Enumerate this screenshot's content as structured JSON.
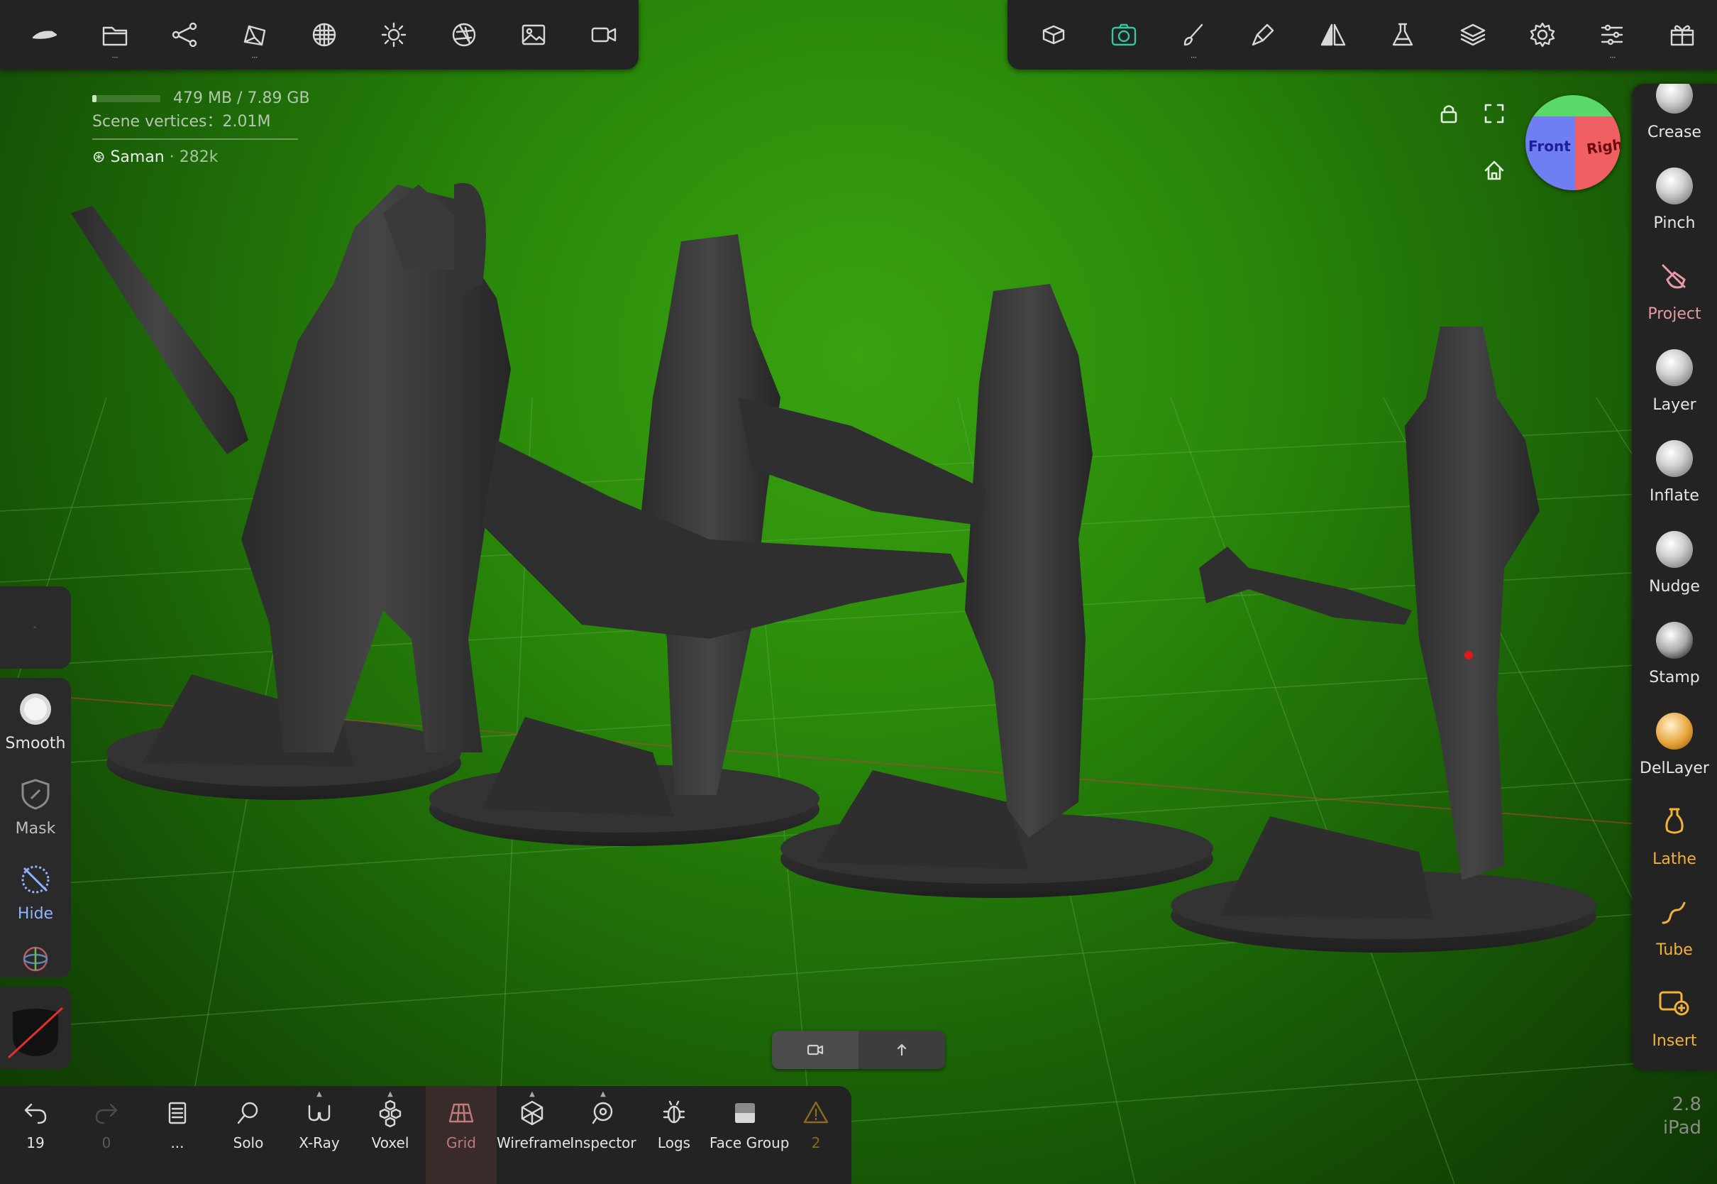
{
  "toolbar_left": {
    "items": [
      {
        "icon": "nomad-logo-icon"
      },
      {
        "icon": "folder-icon"
      },
      {
        "icon": "scene-graph-icon"
      },
      {
        "icon": "topology-icon"
      },
      {
        "icon": "material-sphere-icon"
      },
      {
        "icon": "sun-light-icon"
      },
      {
        "icon": "aperture-icon"
      },
      {
        "icon": "image-icon"
      },
      {
        "icon": "video-camera-icon"
      }
    ]
  },
  "toolbar_right": {
    "items": [
      {
        "icon": "camera-view-icon"
      },
      {
        "icon": "screenshot-camera-icon",
        "active": true
      },
      {
        "icon": "brush-icon"
      },
      {
        "icon": "paint-brush-icon"
      },
      {
        "icon": "symmetry-icon"
      },
      {
        "icon": "flask-icon"
      },
      {
        "icon": "layers-icon"
      },
      {
        "icon": "settings-gear-icon"
      },
      {
        "icon": "sliders-icon"
      },
      {
        "icon": "gift-icon"
      }
    ]
  },
  "stats": {
    "memory": "479 MB / 7.89 GB",
    "memory_fraction": 0.06,
    "scene_vertices": "Scene vertices：2.01M",
    "object_name": "Saman",
    "object_sub": "· 282k"
  },
  "navcube": {
    "front": "Front",
    "right": "Right"
  },
  "right_tools": [
    {
      "label": "Crease",
      "style": "normal"
    },
    {
      "label": "Pinch",
      "style": "normal"
    },
    {
      "label": "Project",
      "style": "pink"
    },
    {
      "label": "Layer",
      "style": "normal"
    },
    {
      "label": "Inflate",
      "style": "normal"
    },
    {
      "label": "Nudge",
      "style": "normal"
    },
    {
      "label": "Stamp",
      "style": "normal"
    },
    {
      "label": "DelLayer",
      "style": "normal"
    },
    {
      "label": "Lathe",
      "style": "orange"
    },
    {
      "label": "Tube",
      "style": "orange"
    },
    {
      "label": "Insert",
      "style": "orange"
    }
  ],
  "left_tools": {
    "top_box": "-",
    "smooth": "Smooth",
    "mask": "Mask",
    "hide": "Hide"
  },
  "bottom_bar": {
    "undo_count": "19",
    "redo_count": "0",
    "more": "...",
    "solo": "Solo",
    "xray": "X-Ray",
    "voxel": "Voxel",
    "grid": "Grid",
    "wireframe": "Wireframe",
    "inspector": "Inspector",
    "logs": "Logs",
    "face_group": "Face Group",
    "warnings": "2"
  },
  "version": {
    "number": "2.8",
    "device": "iPad"
  },
  "colors": {
    "accent": "#33c7a6",
    "background_green": "#2a8a0a",
    "panel": "#232323"
  }
}
